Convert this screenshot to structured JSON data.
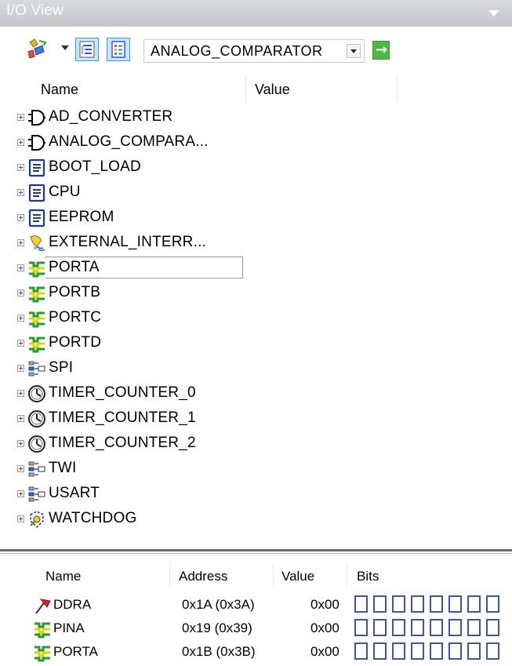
{
  "window": {
    "title": "I/O View"
  },
  "toolbar": {
    "combo_value": "ANALOG_COMPARATOR",
    "icons": [
      "filter-icon",
      "tree-view-icon",
      "list-view-icon",
      "go-arrow-icon"
    ]
  },
  "tree": {
    "headers": {
      "name": "Name",
      "value": "Value"
    },
    "selected": "PORTA",
    "items": [
      {
        "label": "AD_CONVERTER",
        "icon": "and-gate-icon"
      },
      {
        "label": "ANALOG_COMPARA...",
        "icon": "and-gate-icon"
      },
      {
        "label": "BOOT_LOAD",
        "icon": "document-icon"
      },
      {
        "label": "CPU",
        "icon": "document-icon"
      },
      {
        "label": "EEPROM",
        "icon": "document-icon"
      },
      {
        "label": "EXTERNAL_INTERR...",
        "icon": "interrupt-bell-icon"
      },
      {
        "label": "PORTA",
        "icon": "port-icon"
      },
      {
        "label": "PORTB",
        "icon": "port-icon"
      },
      {
        "label": "PORTC",
        "icon": "port-icon"
      },
      {
        "label": "PORTD",
        "icon": "port-icon"
      },
      {
        "label": "SPI",
        "icon": "serial-icon"
      },
      {
        "label": "TIMER_COUNTER_0",
        "icon": "timer-icon"
      },
      {
        "label": "TIMER_COUNTER_1",
        "icon": "timer-icon"
      },
      {
        "label": "TIMER_COUNTER_2",
        "icon": "timer-icon"
      },
      {
        "label": "TWI",
        "icon": "serial-icon"
      },
      {
        "label": "USART",
        "icon": "serial-icon"
      },
      {
        "label": "WATCHDOG",
        "icon": "watchdog-icon"
      }
    ]
  },
  "registers": {
    "headers": {
      "name": "Name",
      "address": "Address",
      "value": "Value",
      "bits": "Bits"
    },
    "rows": [
      {
        "name": "DDRA",
        "address": "0x1A (0x3A)",
        "value": "0x00",
        "icon": "direction-flag-icon",
        "bits": [
          0,
          0,
          0,
          0,
          0,
          0,
          0,
          0
        ]
      },
      {
        "name": "PINA",
        "address": "0x19 (0x39)",
        "value": "0x00",
        "icon": "port-icon",
        "bits": [
          0,
          0,
          0,
          0,
          0,
          0,
          0,
          0
        ]
      },
      {
        "name": "PORTA",
        "address": "0x1B (0x3B)",
        "value": "0x00",
        "icon": "port-icon",
        "bits": [
          0,
          0,
          0,
          0,
          0,
          0,
          0,
          0
        ]
      }
    ]
  },
  "colors": {
    "bit_border": "#3f55a8",
    "port_icon": "#e8e800",
    "port_icon_dark": "#2a9a2a",
    "title_bar": "#cfd1d6"
  }
}
